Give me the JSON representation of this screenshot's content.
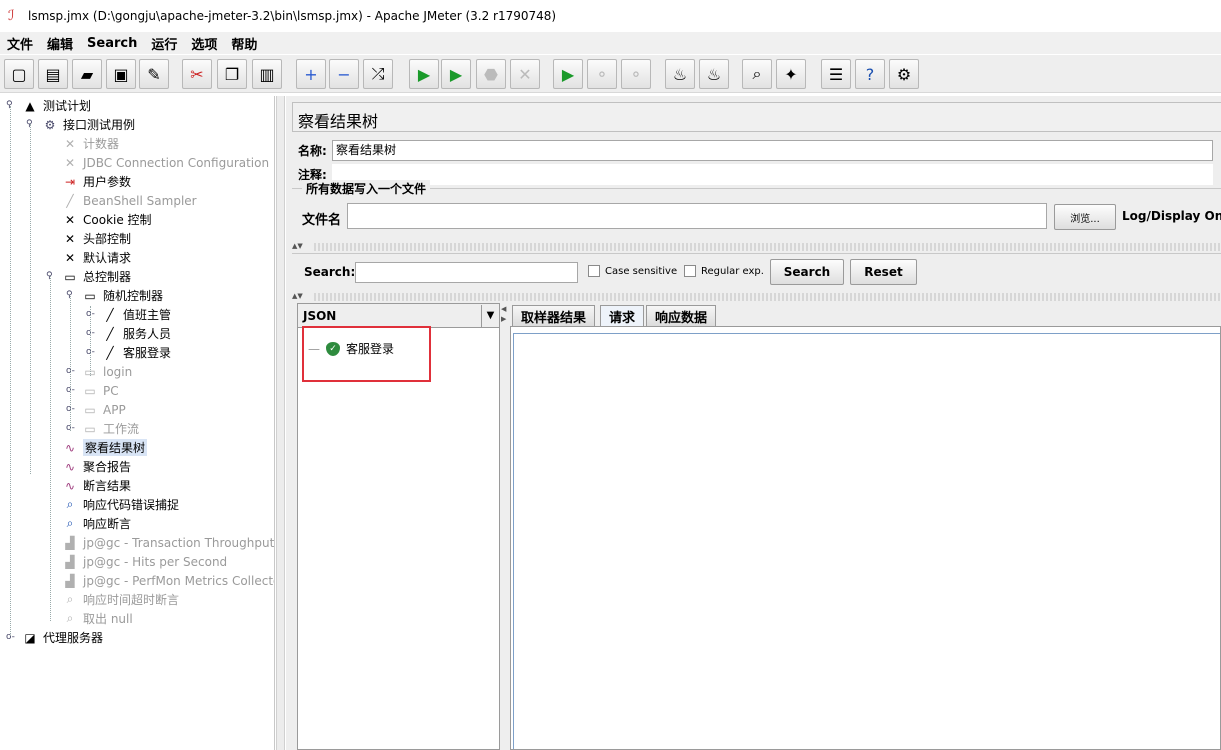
{
  "window": {
    "title": "lsmsp.jmx (D:\\gongju\\apache-jmeter-3.2\\bin\\lsmsp.jmx) - Apache JMeter (3.2 r1790748)"
  },
  "menu": [
    "文件",
    "编辑",
    "Search",
    "运行",
    "选项",
    "帮助"
  ],
  "toolbar": [
    {
      "name": "new-icon",
      "glyph": "▢"
    },
    {
      "name": "templates-icon",
      "glyph": "▤"
    },
    {
      "name": "open-icon",
      "glyph": "▰"
    },
    {
      "name": "save-icon",
      "glyph": "▣"
    },
    {
      "name": "save-as-icon",
      "glyph": "✎"
    },
    {
      "name": "cut-icon",
      "glyph": "✂"
    },
    {
      "name": "copy-icon",
      "glyph": "❐"
    },
    {
      "name": "paste-icon",
      "glyph": "▥"
    },
    {
      "name": "expand-icon",
      "glyph": "+"
    },
    {
      "name": "collapse-icon",
      "glyph": "−"
    },
    {
      "name": "toggle-icon",
      "glyph": "⤮"
    },
    {
      "name": "start-icon",
      "glyph": "▶"
    },
    {
      "name": "start-no-pause-icon",
      "glyph": "▶"
    },
    {
      "name": "stop-icon",
      "glyph": "⬣"
    },
    {
      "name": "shutdown-icon",
      "glyph": "✕"
    },
    {
      "name": "remote-start-icon",
      "glyph": "▶"
    },
    {
      "name": "remote-stop-icon",
      "glyph": "⚬"
    },
    {
      "name": "remote-shutdown-icon",
      "glyph": "⚬"
    },
    {
      "name": "clear-icon",
      "glyph": "♨"
    },
    {
      "name": "clear-all-icon",
      "glyph": "♨"
    },
    {
      "name": "search-icon",
      "glyph": "⌕"
    },
    {
      "name": "reset-search-icon",
      "glyph": "✦"
    },
    {
      "name": "function-helper-icon",
      "glyph": "☰"
    },
    {
      "name": "help-icon",
      "glyph": "?"
    },
    {
      "name": "log-icon",
      "glyph": "⚙"
    }
  ],
  "tree": [
    {
      "label": "测试计划",
      "dim": false,
      "icon": "▲"
    },
    {
      "label": "接口测试用例",
      "dim": false,
      "icon": "⚙"
    },
    {
      "label": "计数器",
      "dim": true,
      "icon": "✕"
    },
    {
      "label": "JDBC Connection Configuration",
      "dim": true,
      "icon": "✕"
    },
    {
      "label": "用户参数",
      "dim": false,
      "icon": "⇥"
    },
    {
      "label": "BeanShell Sampler",
      "dim": true,
      "icon": "╱"
    },
    {
      "label": "Cookie 控制",
      "dim": false,
      "icon": "✕"
    },
    {
      "label": "头部控制",
      "dim": false,
      "icon": "✕"
    },
    {
      "label": "默认请求",
      "dim": false,
      "icon": "✕"
    },
    {
      "label": "总控制器",
      "dim": false,
      "icon": "▭"
    },
    {
      "label": "随机控制器",
      "dim": false,
      "icon": "▭"
    },
    {
      "label": "值班主管",
      "dim": false,
      "icon": "╱"
    },
    {
      "label": "服务人员",
      "dim": false,
      "icon": "╱"
    },
    {
      "label": "客服登录",
      "dim": false,
      "icon": "╱"
    },
    {
      "label": "login",
      "dim": true,
      "icon": "▭"
    },
    {
      "label": "PC",
      "dim": true,
      "icon": "▭"
    },
    {
      "label": "APP",
      "dim": true,
      "icon": "▭"
    },
    {
      "label": "工作流",
      "dim": true,
      "icon": "▭"
    },
    {
      "label": "察看结果树",
      "dim": false,
      "icon": "∿"
    },
    {
      "label": "聚合报告",
      "dim": false,
      "icon": "∿"
    },
    {
      "label": "断言结果",
      "dim": false,
      "icon": "∿"
    },
    {
      "label": "响应代码错误捕捉",
      "dim": false,
      "icon": "⌕"
    },
    {
      "label": "响应断言",
      "dim": false,
      "icon": "⌕"
    },
    {
      "label": "jp@gc - Transaction Throughput vs",
      "dim": true,
      "icon": "▟"
    },
    {
      "label": "jp@gc - Hits per Second",
      "dim": true,
      "icon": "▟"
    },
    {
      "label": "jp@gc - PerfMon Metrics Collector",
      "dim": true,
      "icon": "▟"
    },
    {
      "label": "响应时间超时断言",
      "dim": true,
      "icon": "⌕"
    },
    {
      "label": "取出 null",
      "dim": true,
      "icon": "⌕"
    },
    {
      "label": "代理服务器",
      "dim": false,
      "icon": "◪"
    }
  ],
  "panel": {
    "title": "察看结果树",
    "name_label": "名称:",
    "name_value": "察看结果树",
    "comment_label": "注释:",
    "comment_value": "",
    "file_group_title": "所有数据写入一个文件",
    "file_label": "文件名",
    "file_value": "",
    "browse_button": "浏览...",
    "log_display_label": "Log/Display Only:",
    "search_label": "Search:",
    "search_value": "",
    "case_sensitive": "Case sensitive",
    "regular_exp": "Regular exp.",
    "search_button": "Search",
    "reset_button": "Reset",
    "renderer": "JSON",
    "result_node": "客服登录",
    "tabs": [
      "取样器结果",
      "请求",
      "响应数据"
    ],
    "active_tab": 1
  }
}
